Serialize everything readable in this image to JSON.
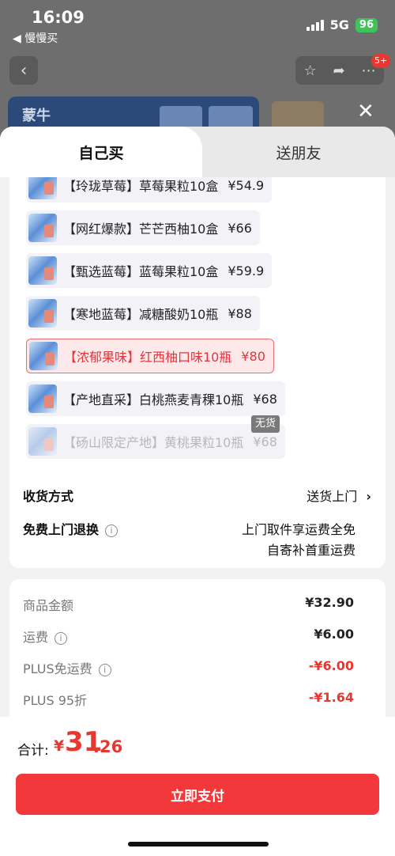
{
  "status": {
    "time": "16:09",
    "back_app": "◀ 慢慢买",
    "network": "5G",
    "battery": "96"
  },
  "background": {
    "notification_badge": "5+",
    "brand_logo": "蒙牛"
  },
  "tabs": [
    {
      "label": "自己买"
    },
    {
      "label": "送朋友"
    }
  ],
  "variants": [
    {
      "name": "【玲珑草莓】草莓果粒10盒",
      "price": "¥54.9"
    },
    {
      "name": "【网红爆款】芒芒西柚10盒",
      "price": "¥66"
    },
    {
      "name": "【甄选蓝莓】蓝莓果粒10盒",
      "price": "¥59.9"
    },
    {
      "name": "【寒地蓝莓】减糖酸奶10瓶",
      "price": "¥88"
    },
    {
      "name": "【浓郁果味】红西柚口味10瓶",
      "price": "¥80"
    },
    {
      "name": "【产地直采】白桃燕麦青稞10瓶",
      "price": "¥68"
    },
    {
      "name": "【砀山限定产地】黄桃果粒10瓶",
      "price": "¥68"
    }
  ],
  "no_stock_tag": "无货",
  "delivery": {
    "label": "收货方式",
    "value": "送货上门"
  },
  "free_return": {
    "label": "免费上门退换",
    "line1": "上门取件享运费全免",
    "line2": "自寄补首重运费"
  },
  "fees": [
    {
      "label": "商品金额",
      "value": "¥32.90",
      "info": false,
      "red": false
    },
    {
      "label": "运费",
      "value": "¥6.00",
      "info": true,
      "red": false
    },
    {
      "label": "PLUS免运费",
      "value": "-¥6.00",
      "info": true,
      "red": true
    },
    {
      "label": "PLUS 95折",
      "value": "-¥1.64",
      "info": false,
      "red": true
    }
  ],
  "total": {
    "label": "合计:",
    "currency": "¥",
    "integer": "31",
    "decimal": ".26"
  },
  "pay_button": "立即支付"
}
